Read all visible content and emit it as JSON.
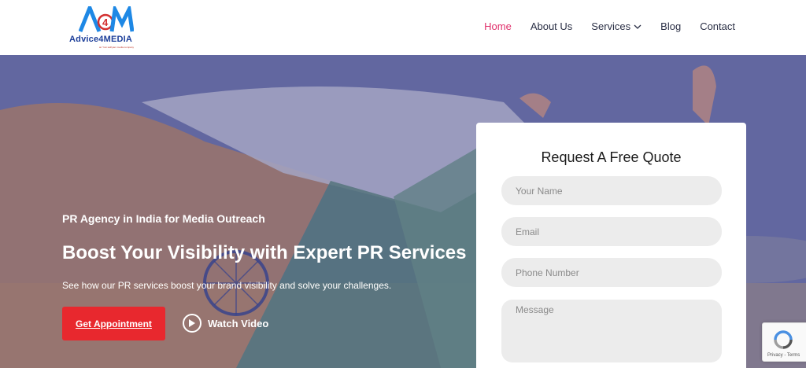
{
  "brand": {
    "logo_letters": "A4M",
    "name": "Advice4MEDIA",
    "tagline": "an Yuvi sathyam media company"
  },
  "nav": {
    "items": [
      {
        "label": "Home",
        "active": true
      },
      {
        "label": "About Us",
        "active": false
      },
      {
        "label": "Services",
        "active": false,
        "dropdown": true
      },
      {
        "label": "Blog",
        "active": false
      },
      {
        "label": "Contact",
        "active": false
      }
    ]
  },
  "hero": {
    "eyebrow": "PR Agency in India for Media Outreach",
    "headline": "Boost Your Visibility with Expert PR Services",
    "subtext": "See how our PR services boost your brand visibility and solve your challenges.",
    "primary_button": "Get Appointment",
    "video_button": "Watch Video"
  },
  "quote_form": {
    "title": "Request A Free Quote",
    "name_placeholder": "Your Name",
    "email_placeholder": "Email",
    "phone_placeholder": "Phone Number",
    "message_placeholder": "Message"
  },
  "recaptcha": {
    "text": "Privacy - Terms"
  },
  "colors": {
    "accent": "#e0306b",
    "button": "#e8282e",
    "brand_blue": "#1d3f9a"
  }
}
